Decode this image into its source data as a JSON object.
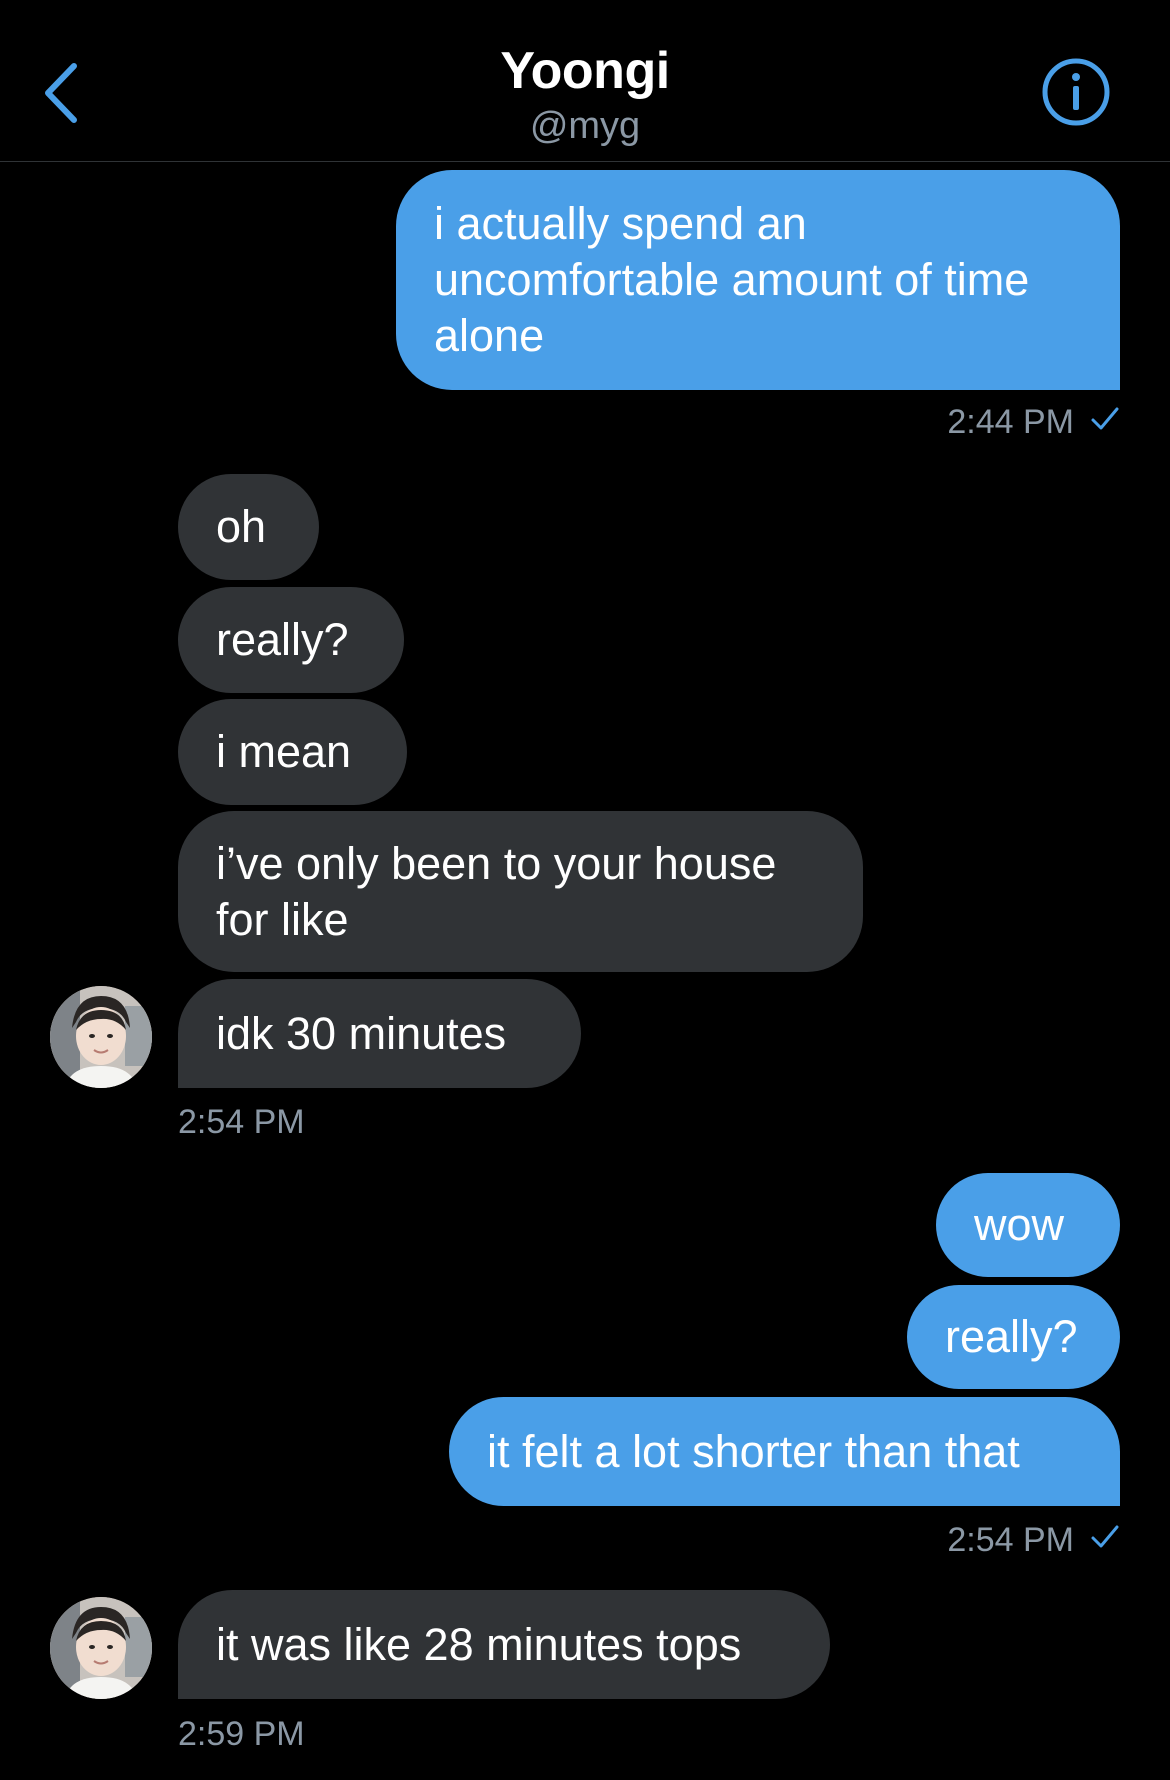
{
  "header": {
    "title": "Yoongi",
    "handle": "@myg",
    "back_icon": "chevron-left-icon",
    "info_icon": "info-circle-icon",
    "accent_color": "#4a9fe8"
  },
  "messages": [
    {
      "side": "sent",
      "text": "i actually spend an uncomfortable amount of time alone"
    },
    {
      "side": "sent_meta",
      "time": "2:44 PM"
    },
    {
      "side": "recv",
      "text": "oh"
    },
    {
      "side": "recv",
      "text": "really?"
    },
    {
      "side": "recv",
      "text": "i mean"
    },
    {
      "side": "recv",
      "text": "i’ve only been to your house for like"
    },
    {
      "side": "recv",
      "text": "idk 30 minutes"
    },
    {
      "side": "recv_meta",
      "time": "2:54 PM"
    },
    {
      "side": "sent",
      "text": "wow"
    },
    {
      "side": "sent",
      "text": "really?"
    },
    {
      "side": "sent",
      "text": "it felt a lot shorter than that"
    },
    {
      "side": "sent_meta",
      "time": "2:54 PM"
    },
    {
      "side": "recv",
      "text": "it was like 28 minutes tops"
    },
    {
      "side": "recv_meta",
      "time": "2:59 PM"
    }
  ],
  "colors": {
    "sent_bubble": "#4a9fe8",
    "recv_bubble": "#303336",
    "meta_text": "#8b98a5"
  }
}
